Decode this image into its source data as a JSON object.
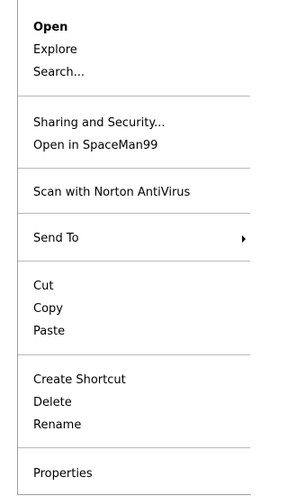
{
  "context_menu": {
    "items": {
      "open": "Open",
      "explore": "Explore",
      "search": "Search...",
      "sharing_security": "Sharing and Security...",
      "open_spaceman": "Open in SpaceMan99",
      "scan_norton": "Scan with Norton AntiVirus",
      "send_to": "Send To",
      "cut": "Cut",
      "copy": "Copy",
      "paste": "Paste",
      "create_shortcut": "Create Shortcut",
      "delete": "Delete",
      "rename": "Rename",
      "properties": "Properties"
    },
    "icons": {
      "submenu_arrow": "submenu-arrow-icon"
    }
  }
}
